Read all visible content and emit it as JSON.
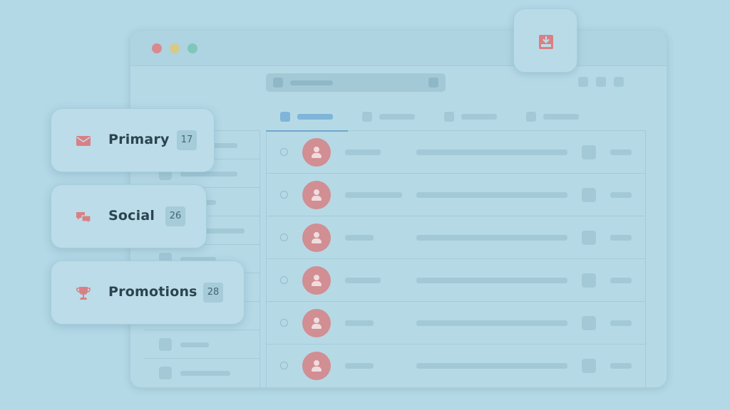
{
  "categories": [
    {
      "label": "Primary",
      "count": "17",
      "icon": "envelope-icon"
    },
    {
      "label": "Social",
      "count": "26",
      "icon": "chat-bubbles-icon"
    },
    {
      "label": "Promotions",
      "count": "28",
      "icon": "trophy-icon"
    }
  ],
  "inbox_icon": "inbox-download-icon",
  "window_controls": [
    "close",
    "minimize",
    "maximize"
  ],
  "colors": {
    "background": "#b3d8e6",
    "accent_icon": "#d98085",
    "avatar": "#d18e93",
    "active_tab": "#7fb5d8",
    "text": "#2b4450"
  }
}
